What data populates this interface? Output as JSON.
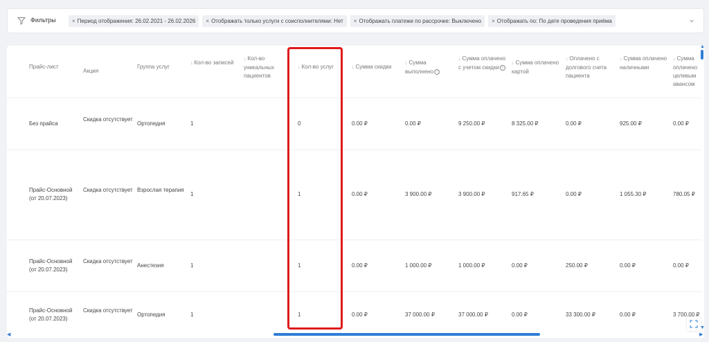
{
  "filters": {
    "label": "Фильтры",
    "tags": [
      "Период отображения: 26.02.2021 - 26.02.2026",
      "Отображать только услуги с соисполнителями: Нет",
      "Отображать платежи по рассрочке: Выключено",
      "Отображать по: По дате проведения приёма"
    ],
    "close_glyph": "×"
  },
  "table": {
    "headers": [
      "Прайс-лист",
      "Акция",
      "Группа услуг",
      "Кол-во записей",
      "Кол-во уникальных пациентов",
      "Кол-во услуг",
      "Сумма скидки",
      "Сумма выполнено",
      "Сумма оплачено с учетом скидки",
      "Сумма оплачено картой",
      "Оплачено с долгового счета пациента",
      "Сумма оплачено наличными",
      "Сумма оплачено целевым авансом"
    ],
    "rows": [
      [
        "Без прайса",
        "Скидка отсутствует",
        "Ортопедия",
        "1",
        "",
        "0",
        "0.00 ₽",
        "0.00 ₽",
        "9 250.00 ₽",
        "8 325.00 ₽",
        "0.00 ₽",
        "925.00 ₽",
        "0.00 ₽"
      ],
      [
        "Прайс-Основной (от 20.07.2023)",
        "Скидка отсутствует",
        "Взрослая терапия",
        "1",
        "",
        "1",
        "0.00 ₽",
        "3 900.00 ₽",
        "3 900.00 ₽",
        "917.65 ₽",
        "0.00 ₽",
        "1 055.30 ₽",
        "780.05 ₽"
      ],
      [
        "Прайс-Основной (от 20.07.2023)",
        "Скидка отсутствует",
        "Анестезия",
        "1",
        "",
        "1",
        "0.00 ₽",
        "1 000.00 ₽",
        "1 000.00 ₽",
        "0.00 ₽",
        "250.00 ₽",
        "0.00 ₽",
        "0.00 ₽"
      ],
      [
        "Прайс-Основной (от 20.07.2023)",
        "Скидка отсутствует",
        "Ортопедия",
        "1",
        "",
        "1",
        "0.00 ₽",
        "37 000.00 ₽",
        "37 000.00 ₽",
        "0.00 ₽",
        "33 300.00 ₽",
        "0.00 ₽",
        "3 700.00 ₽"
      ]
    ]
  },
  "colors": {
    "accent": "#2f7dd6",
    "highlight": "#e01919"
  }
}
